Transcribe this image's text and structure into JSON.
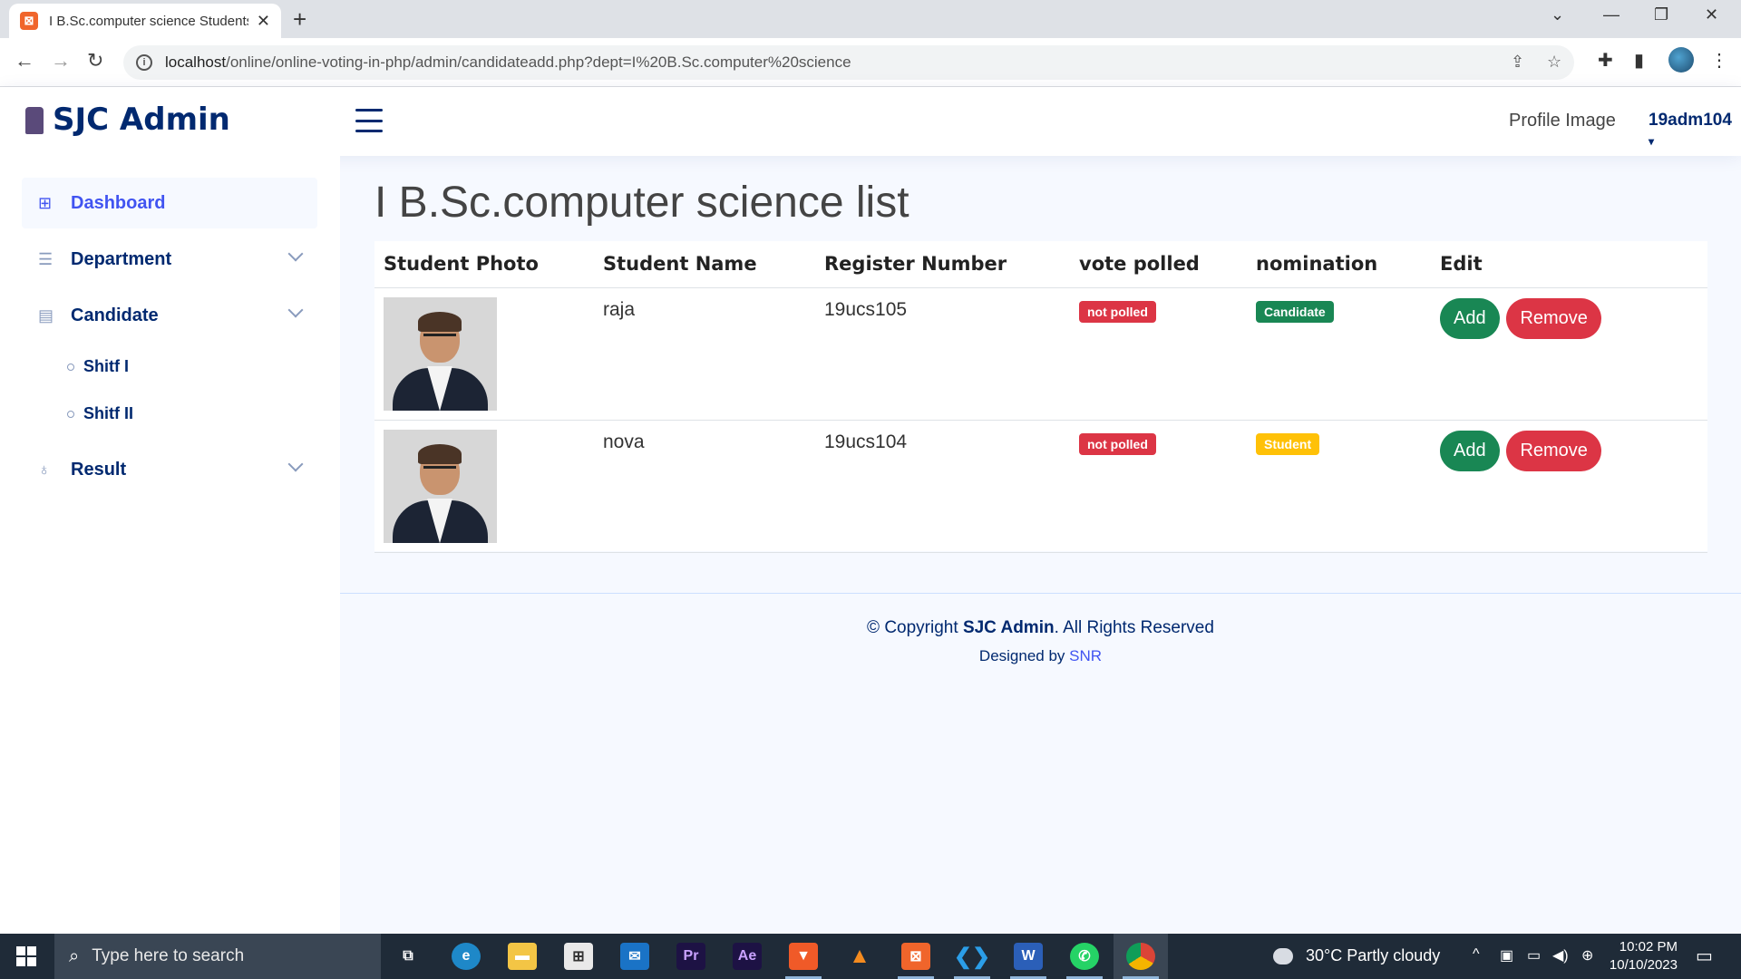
{
  "browser": {
    "tab_title": "I B.Sc.computer science Students",
    "url_host": "localhost",
    "url_path": "/online/online-voting-in-php/admin/candidateadd.php?dept=I%20B.Sc.computer%20science"
  },
  "header": {
    "brand": "SJC Admin",
    "profile_image_alt": "Profile Image",
    "username": "19adm104"
  },
  "sidebar": {
    "items": [
      {
        "label": "Dashboard",
        "icon": "grid-icon"
      },
      {
        "label": "Department",
        "icon": "list-icon"
      },
      {
        "label": "Candidate",
        "icon": "document-icon"
      },
      {
        "label": "Result",
        "icon": "trophy-icon"
      }
    ],
    "candidate_sub": [
      {
        "label": "Shitf I"
      },
      {
        "label": "Shitf II"
      }
    ]
  },
  "main": {
    "title": "I B.Sc.computer science list",
    "columns": [
      "Student Photo",
      "Student Name",
      "Register Number",
      "vote polled",
      "nomination",
      "Edit"
    ],
    "rows": [
      {
        "name": "raja",
        "register": "19ucs105",
        "vote": "not polled",
        "nomination": "Candidate",
        "add": "Add",
        "remove": "Remove"
      },
      {
        "name": "nova",
        "register": "19ucs104",
        "vote": "not polled",
        "nomination": "Student",
        "add": "Add",
        "remove": "Remove"
      }
    ]
  },
  "footer": {
    "copyright_prefix": "© Copyright",
    "copyright_brand": "SJC Admin",
    "copyright_suffix": ". All Rights Reserved",
    "designed_prefix": "Designed by",
    "designed_by": "SNR"
  },
  "taskbar": {
    "search_placeholder": "Type here to search",
    "weather": "30°C  Partly cloudy",
    "time": "10:02 PM",
    "date": "10/10/2023"
  },
  "colors": {
    "brand": "#012970",
    "accent": "#4154f1",
    "success": "#198754",
    "danger": "#dc3545",
    "warning": "#ffc107"
  }
}
